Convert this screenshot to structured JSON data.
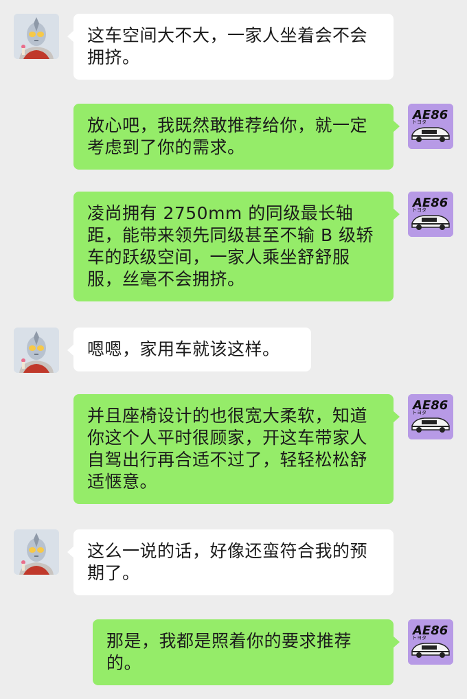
{
  "chat": {
    "messages": [
      {
        "side": "left",
        "avatar": "ultraman-avatar",
        "text": "这车空间大不大，一家人坐着会不会拥挤。"
      },
      {
        "side": "right",
        "avatar": "ae86-avatar",
        "text": "放心吧，我既然敢推荐给你，就一定考虑到了你的需求。"
      },
      {
        "side": "right",
        "avatar": "ae86-avatar",
        "text": "凌尚拥有 2750mm 的同级最长轴距，能带来领先同级甚至不输 B 级轿车的跃级空间，一家人乘坐舒舒服服，丝毫不会拥挤。"
      },
      {
        "side": "left",
        "avatar": "ultraman-avatar",
        "text": "嗯嗯，家用车就该这样。"
      },
      {
        "side": "right",
        "avatar": "ae86-avatar",
        "text": "并且座椅设计的也很宽大柔软，知道你这个人平时很顾家，开这车带家人自驾出行再合适不过了，轻轻松松舒适惬意。"
      },
      {
        "side": "left",
        "avatar": "ultraman-avatar",
        "text": "这么一说的话，好像还蛮符合我的预期了。"
      },
      {
        "side": "right",
        "avatar": "ae86-avatar",
        "text": "那是，我都是照着你的要求推荐的。"
      }
    ],
    "ae86_logo": {
      "main": "AE86",
      "sub": "トヨタ"
    }
  },
  "colors": {
    "background": "#ededed",
    "self_bubble": "#95ec69",
    "other_bubble": "#ffffff",
    "ae86_avatar_bg": "#b79ae6"
  }
}
